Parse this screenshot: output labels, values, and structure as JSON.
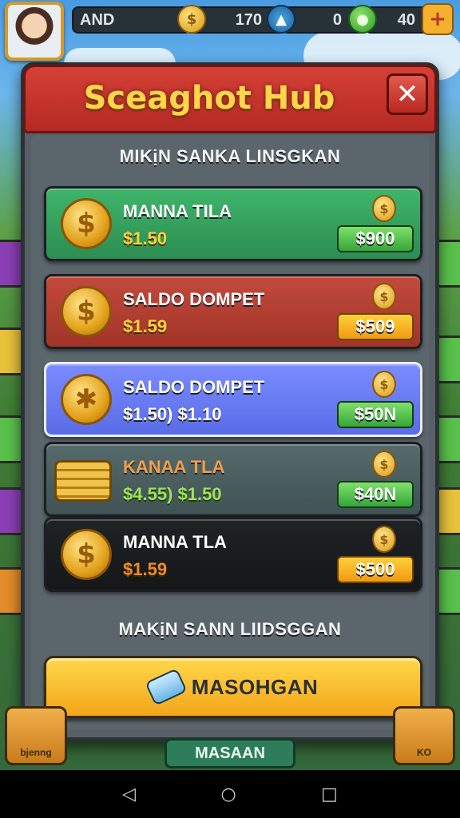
{
  "hud": {
    "player_name": "AND",
    "coins": "170",
    "gems": "0",
    "energy": "40",
    "icons": [
      "coin-icon",
      "compass-icon",
      "gem-icon",
      "plus-icon"
    ]
  },
  "modal": {
    "title": "Sceaghot Hub",
    "close_symbol": "✕",
    "subheading_top": "MIKịN SANKA LINSGKAN",
    "subheading_bottom": "MAKịN SANN LIIDSGGAN",
    "offers": [
      {
        "name": "MANNA TILA",
        "price": "$1.50",
        "button": "$900",
        "theme": "green"
      },
      {
        "name": "SALDO DOMPET",
        "price": "$1.59",
        "button": "$509",
        "theme": "red"
      },
      {
        "name": "SALDO DOMPET",
        "price": "$1.50) $1.10",
        "button": "$50N",
        "theme": "blue"
      },
      {
        "name": "KANAA TLA",
        "price": "$4.55) $1.50",
        "button": "$40N",
        "theme": "teal"
      },
      {
        "name": "MANNA TLA",
        "price": "$1.59",
        "button": "$500",
        "theme": "dark"
      }
    ],
    "cta_label": "MASOHGAN"
  },
  "bottom": {
    "tab_label": "MASAAN",
    "left_corner_label": "bjenng",
    "right_corner_label": "KO"
  },
  "navbar": {
    "back": "◁",
    "home": "○",
    "recents": "□"
  }
}
